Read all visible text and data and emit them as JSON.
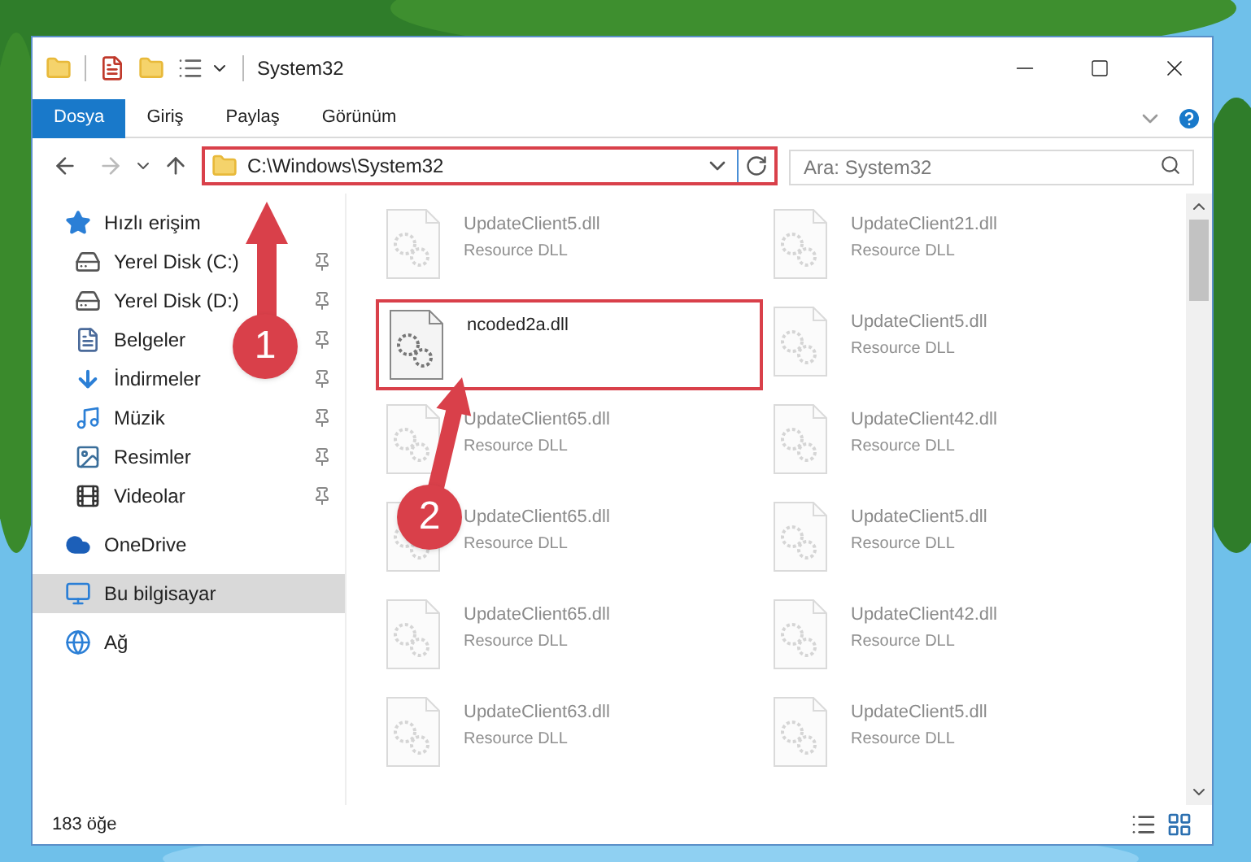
{
  "window": {
    "title": "System32"
  },
  "ribbon": {
    "tabs": [
      {
        "label": "Dosya",
        "selected": true
      },
      {
        "label": "Giriş",
        "selected": false
      },
      {
        "label": "Paylaş",
        "selected": false
      },
      {
        "label": "Görünüm",
        "selected": false
      }
    ]
  },
  "address_bar": {
    "path": "C:\\Windows\\System32",
    "highlighted": true
  },
  "search": {
    "placeholder": "Ara: System32"
  },
  "sidebar": {
    "items": [
      {
        "label": "Hızlı erişim",
        "kind": "star",
        "selected": false,
        "children": [
          {
            "label": "Yerel Disk (C:)",
            "kind": "drive-c",
            "pinned": true,
            "selected": false
          },
          {
            "label": "Yerel Disk (D:)",
            "kind": "drive",
            "pinned": true,
            "selected": false
          },
          {
            "label": "Belgeler",
            "kind": "docs",
            "pinned": true,
            "selected": false
          },
          {
            "label": "İndirmeler",
            "kind": "download",
            "pinned": true,
            "selected": false
          },
          {
            "label": "Müzik",
            "kind": "music",
            "pinned": true,
            "selected": false
          },
          {
            "label": "Resimler",
            "kind": "pictures",
            "pinned": true,
            "selected": false
          },
          {
            "label": "Videolar",
            "kind": "video",
            "pinned": true,
            "selected": false
          }
        ]
      },
      {
        "label": "OneDrive",
        "kind": "cloud",
        "selected": false
      },
      {
        "label": "Bu bilgisayar",
        "kind": "pc",
        "selected": true
      },
      {
        "label": "Ağ",
        "kind": "network",
        "selected": false
      }
    ]
  },
  "files": [
    {
      "name": "UpdateClient5.dll",
      "type": "Resource DLL",
      "highlighted": false
    },
    {
      "name": "UpdateClient21.dll",
      "type": "Resource DLL",
      "highlighted": false
    },
    {
      "name": "ncoded2a.dll",
      "highlighted": true
    },
    {
      "name": "UpdateClient5.dll",
      "type": "Resource DLL",
      "highlighted": false
    },
    {
      "name": "UpdateClient65.dll",
      "type": "Resource DLL",
      "highlighted": false
    },
    {
      "name": "UpdateClient42.dll",
      "type": "Resource DLL",
      "highlighted": false
    },
    {
      "name": "UpdateClient65.dll",
      "type": "Resource DLL",
      "highlighted": false
    },
    {
      "name": "UpdateClient5.dll",
      "type": "Resource DLL",
      "highlighted": false
    },
    {
      "name": "UpdateClient65.dll",
      "type": "Resource DLL",
      "highlighted": false
    },
    {
      "name": "UpdateClient42.dll",
      "type": "Resource DLL",
      "highlighted": false
    },
    {
      "name": "UpdateClient63.dll",
      "type": "Resource DLL",
      "highlighted": false
    },
    {
      "name": "UpdateClient5.dll",
      "type": "Resource DLL",
      "highlighted": false
    }
  ],
  "status_bar": {
    "count": "183 öğe"
  },
  "annotations": [
    {
      "label": "1"
    },
    {
      "label": "2"
    }
  ]
}
